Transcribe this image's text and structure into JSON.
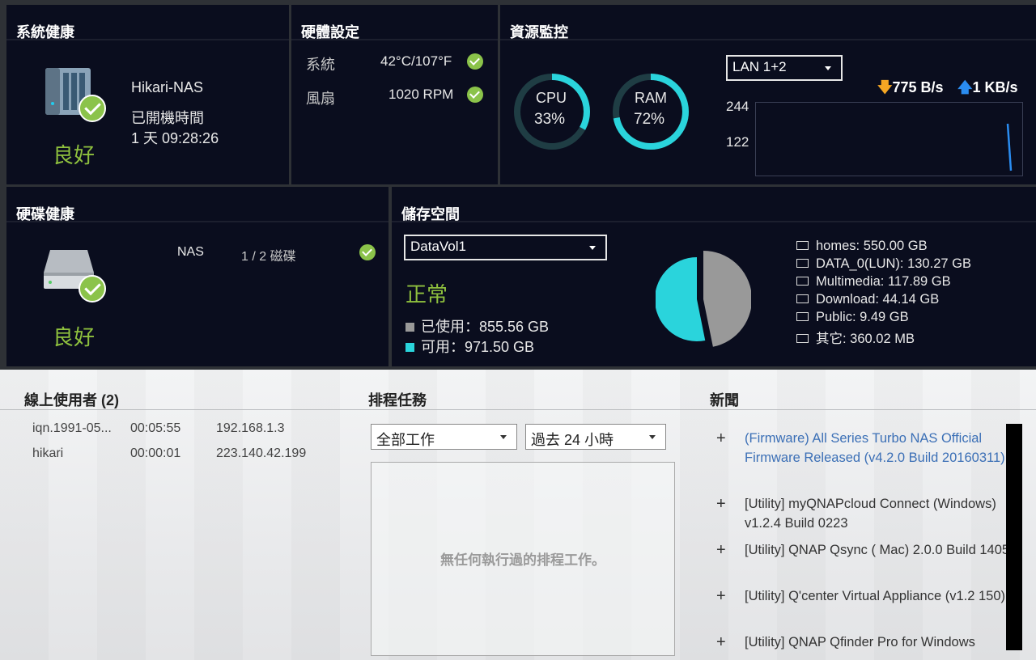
{
  "system_health": {
    "title": "系統健康",
    "device_name": "Hikari-NAS",
    "uptime_label": "已開機時間",
    "uptime_value": "1 天 09:28:26",
    "status": "良好"
  },
  "hardware": {
    "title": "硬體設定",
    "rows": [
      {
        "label": "系統",
        "value": "42°C/107°F"
      },
      {
        "label": "風扇",
        "value": "1020 RPM"
      }
    ]
  },
  "resource": {
    "title": "資源監控",
    "cpu": {
      "label": "CPU",
      "value": "33%",
      "percent": 33
    },
    "ram": {
      "label": "RAM",
      "value": "72%",
      "percent": 72
    },
    "lan_select": "LAN 1+2",
    "download": "775 B/s",
    "upload": "1 KB/s",
    "y_ticks": [
      "244",
      "122"
    ]
  },
  "disk_health": {
    "title": "硬碟健康",
    "name": "NAS",
    "disks": "1 / 2 磁碟",
    "status": "良好"
  },
  "storage": {
    "title": "儲存空間",
    "volume_select": "DataVol1",
    "status": "正常",
    "used_label": "已使用：855.56 GB",
    "free_label": "可用：971.50 GB",
    "used_gb": 855.56,
    "free_gb": 971.5,
    "used_color": "#999999",
    "free_color": "#2ad4dc",
    "folders": [
      "homes: 550.00 GB",
      "DATA_0(LUN): 130.27 GB",
      "Multimedia: 117.89 GB",
      "Download: 44.14 GB",
      "Public: 9.49 GB",
      "其它: 360.02 MB"
    ]
  },
  "online_users": {
    "title": "線上使用者 (2)",
    "rows": [
      {
        "name": "iqn.1991-05...",
        "time": "00:05:55",
        "ip": "192.168.1.3"
      },
      {
        "name": "hikari",
        "time": "00:00:01",
        "ip": "223.140.42.199"
      }
    ]
  },
  "schedule": {
    "title": "排程任務",
    "filter_select": "全部工作",
    "range_select": "過去 24 小時",
    "empty_message": "無任何執行過的排程工作。"
  },
  "news": {
    "title": "新聞",
    "items": [
      {
        "text": "(Firmware) All Series Turbo NAS Official Firmware Released (v4.2.0 Build 20160311)",
        "highlight": true
      },
      {
        "text": "[Utility] myQNAPcloud Connect (Windows) v1.2.4 Build 0223",
        "highlight": false
      },
      {
        "text": "[Utility] QNAP Qsync ( Mac) 2.0.0 Build 1405",
        "highlight": false
      },
      {
        "text": "[Utility] Q'center Virtual Appliance (v1.2 150)",
        "highlight": false
      },
      {
        "text": "[Utility] QNAP Qfinder Pro for Windows",
        "highlight": false
      }
    ]
  }
}
